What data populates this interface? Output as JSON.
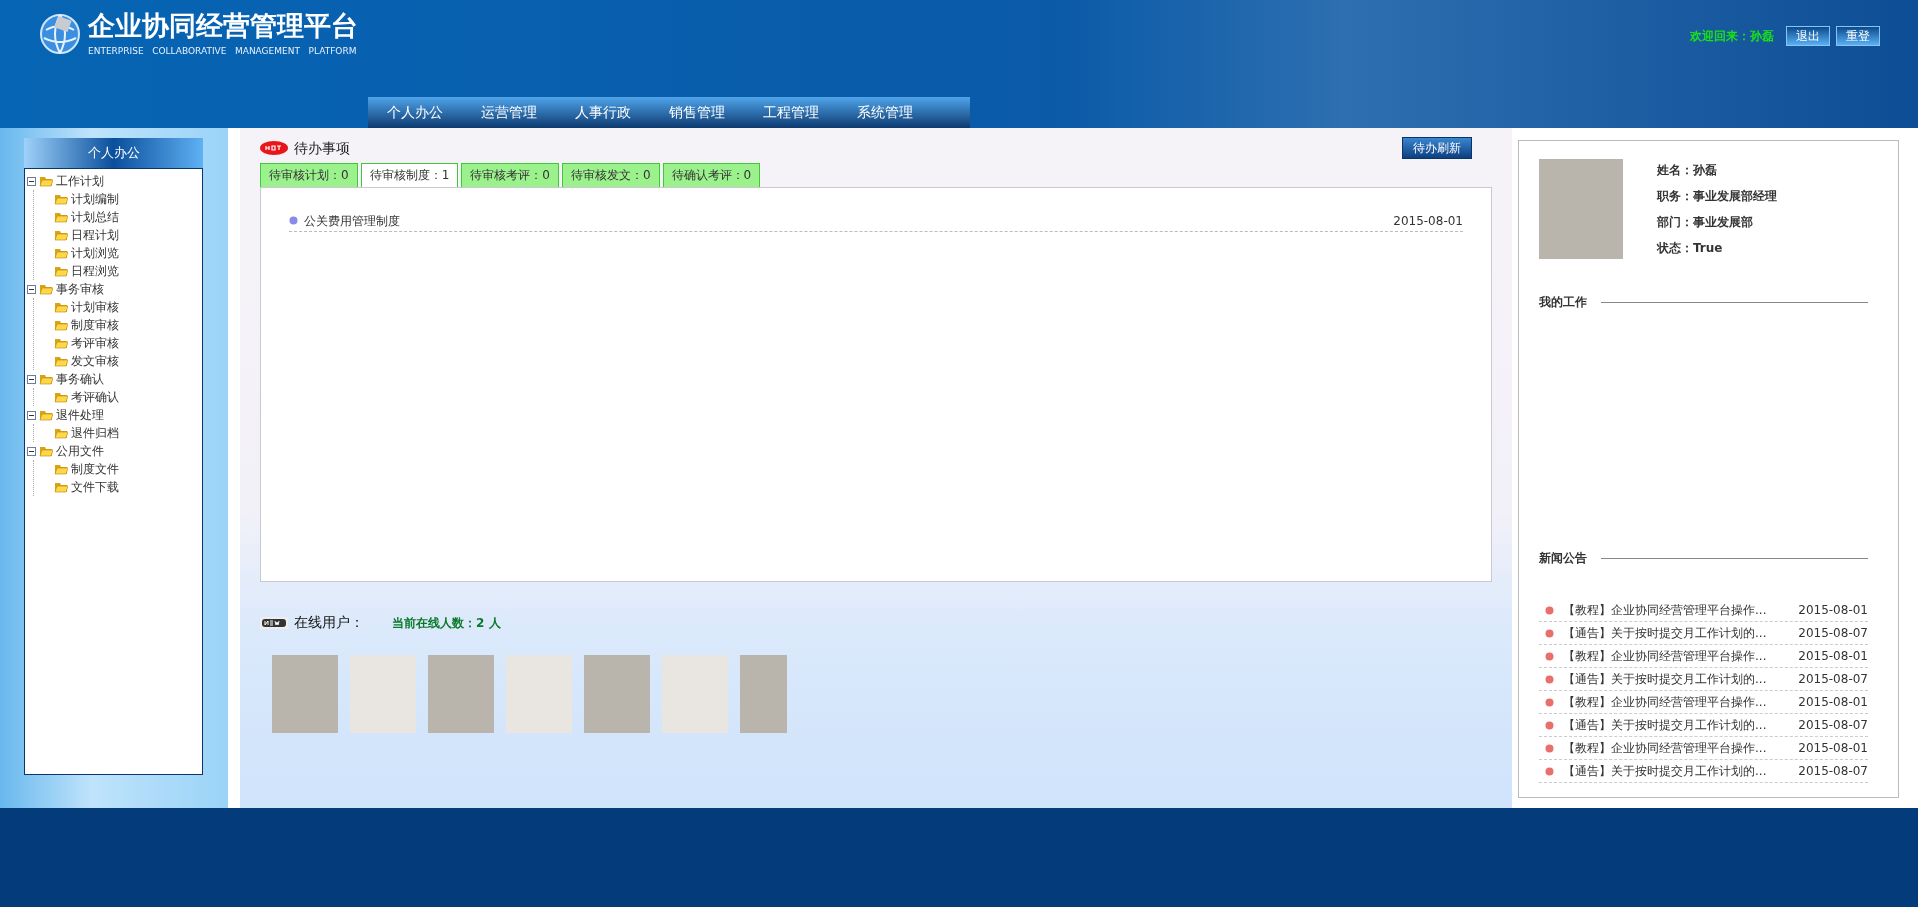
{
  "header": {
    "title": "企业协同经营管理平台",
    "subtitle": "ENTERPRISE   COLLABORATIVE   MANAGEMENT   PLATFORM",
    "welcome": "欢迎回来：孙磊",
    "buttons": [
      "退出",
      "重登"
    ]
  },
  "nav": [
    "个人办公",
    "运营管理",
    "人事行政",
    "销售管理",
    "工程管理",
    "系统管理"
  ],
  "sidebar": {
    "title": "个人办公",
    "tree": [
      {
        "label": "工作计划",
        "expanded": true,
        "children": [
          {
            "label": "计划编制"
          },
          {
            "label": "计划总结"
          },
          {
            "label": "日程计划"
          },
          {
            "label": "计划浏览"
          },
          {
            "label": "日程浏览"
          }
        ]
      },
      {
        "label": "事务审核",
        "expanded": true,
        "children": [
          {
            "label": "计划审核"
          },
          {
            "label": "制度审核"
          },
          {
            "label": "考评审核"
          },
          {
            "label": "发文审核"
          }
        ]
      },
      {
        "label": "事务确认",
        "expanded": true,
        "children": [
          {
            "label": "考评确认"
          }
        ]
      },
      {
        "label": "退件处理",
        "expanded": true,
        "children": [
          {
            "label": "退件归档"
          }
        ]
      },
      {
        "label": "公用文件",
        "expanded": true,
        "children": [
          {
            "label": "制度文件"
          },
          {
            "label": "文件下载"
          }
        ]
      }
    ]
  },
  "todo": {
    "title": "待办事项",
    "refresh_button": "待办刷新",
    "tabs": [
      {
        "label": "待审核计划：0",
        "selected": false
      },
      {
        "label": "待审核制度：1",
        "selected": true
      },
      {
        "label": "待审核考评：0",
        "selected": false
      },
      {
        "label": "待审核发文：0",
        "selected": false
      },
      {
        "label": "待确认考评：0",
        "selected": false
      }
    ],
    "items": [
      {
        "title": "公关费用管理制度",
        "date": "2015-08-01"
      }
    ]
  },
  "online": {
    "title": "在线用户：",
    "count": "当前在线人数：2 人"
  },
  "profile": {
    "fields": [
      "姓名：孙磊",
      "职务：事业发展部经理",
      "部门：事业发展部",
      "状态：True"
    ]
  },
  "my_work": {
    "title": "我的工作"
  },
  "news": {
    "title": "新闻公告",
    "items": [
      {
        "title": "【教程】企业协同经营管理平台操作...",
        "date": "2015-08-01"
      },
      {
        "title": "【通告】关于按时提交月工作计划的...",
        "date": "2015-08-07"
      },
      {
        "title": "【教程】企业协同经营管理平台操作...",
        "date": "2015-08-01"
      },
      {
        "title": "【通告】关于按时提交月工作计划的...",
        "date": "2015-08-07"
      },
      {
        "title": "【教程】企业协同经营管理平台操作...",
        "date": "2015-08-01"
      },
      {
        "title": "【通告】关于按时提交月工作计划的...",
        "date": "2015-08-07"
      },
      {
        "title": "【教程】企业协同经营管理平台操作...",
        "date": "2015-08-01"
      },
      {
        "title": "【通告】关于按时提交月工作计划的...",
        "date": "2015-08-07"
      }
    ]
  }
}
